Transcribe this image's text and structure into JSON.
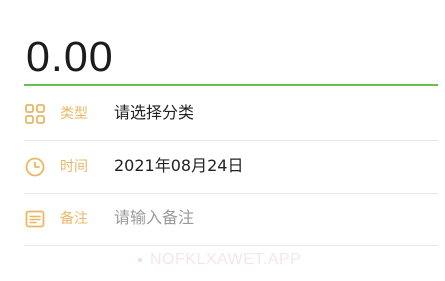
{
  "amount": {
    "value": "0.00"
  },
  "form": {
    "category": {
      "icon": "grid-icon",
      "label": "类型",
      "value": "请选择分类"
    },
    "time": {
      "icon": "clock-icon",
      "label": "时间",
      "value": "2021年08月24日"
    },
    "note": {
      "icon": "note-icon",
      "label": "备注",
      "placeholder": "请输入备注"
    }
  },
  "watermark": {
    "text": "NOFKLXAWET.APP"
  },
  "colors": {
    "accent_green": "#6bbf4e",
    "label_orange": "#e8b866",
    "text_dark": "#222222",
    "placeholder_gray": "#9a9a9a"
  }
}
